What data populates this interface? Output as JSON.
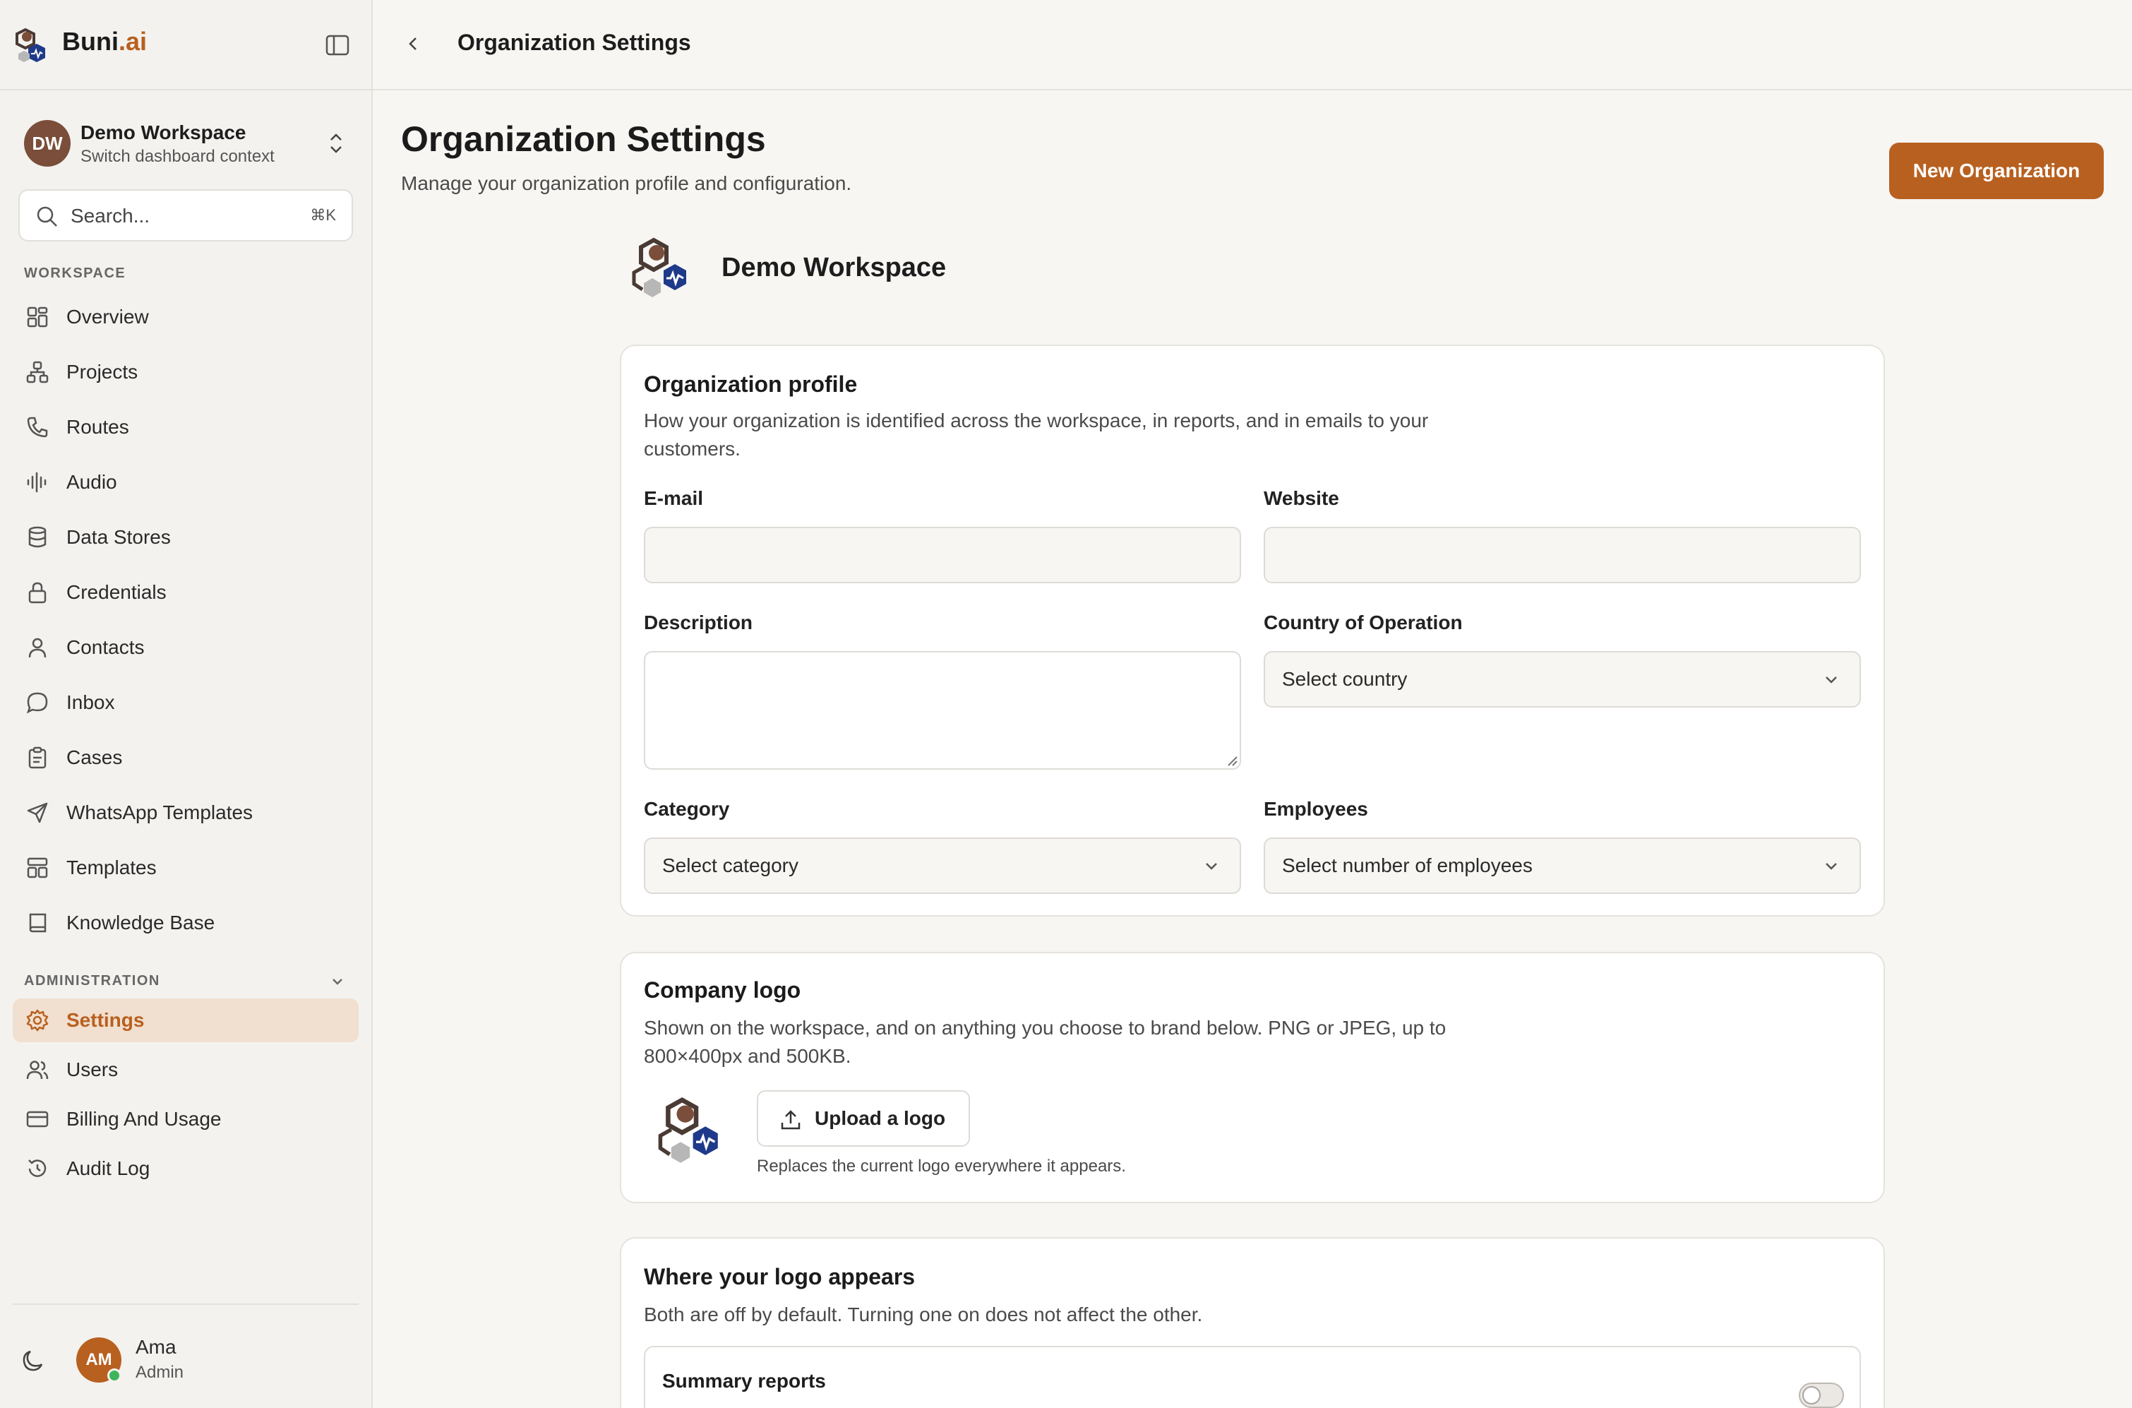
{
  "brand": {
    "name_main": "Buni",
    "name_suffix": ".ai"
  },
  "workspace": {
    "initials": "DW",
    "name": "Demo Workspace",
    "subtitle": "Switch dashboard context"
  },
  "search": {
    "placeholder": "Search...",
    "shortcut": "⌘K"
  },
  "sidebar": {
    "workspace_label": "WORKSPACE",
    "workspace_items": [
      {
        "label": "Overview",
        "icon": "grid-icon"
      },
      {
        "label": "Projects",
        "icon": "hierarchy-icon"
      },
      {
        "label": "Routes",
        "icon": "phone-icon"
      },
      {
        "label": "Audio",
        "icon": "audio-waveform-icon"
      },
      {
        "label": "Data Stores",
        "icon": "database-icon"
      },
      {
        "label": "Credentials",
        "icon": "lock-icon"
      },
      {
        "label": "Contacts",
        "icon": "user-icon"
      },
      {
        "label": "Inbox",
        "icon": "chat-bubble-icon"
      },
      {
        "label": "Cases",
        "icon": "clipboard-icon"
      },
      {
        "label": "WhatsApp Templates",
        "icon": "send-icon"
      },
      {
        "label": "Templates",
        "icon": "layout-icon"
      },
      {
        "label": "Knowledge Base",
        "icon": "book-icon"
      }
    ],
    "admin_label": "ADMINISTRATION",
    "admin_items": [
      {
        "label": "Settings",
        "icon": "gear-icon",
        "active": true
      },
      {
        "label": "Users",
        "icon": "users-icon"
      },
      {
        "label": "Billing And Usage",
        "icon": "credit-card-icon"
      },
      {
        "label": "Audit Log",
        "icon": "history-icon"
      }
    ]
  },
  "user": {
    "initials": "AM",
    "name": "Ama",
    "role": "Admin"
  },
  "topbar": {
    "title": "Organization Settings"
  },
  "page": {
    "title": "Organization Settings",
    "subtitle": "Manage your organization profile and configuration.",
    "new_org_label": "New Organization",
    "org_name": "Demo Workspace"
  },
  "profile": {
    "title": "Organization profile",
    "description": "How your organization is identified across the workspace, in reports, and in emails to your customers.",
    "email_label": "E-mail",
    "email_value": "",
    "website_label": "Website",
    "website_value": "",
    "description_label": "Description",
    "description_value": "",
    "country_label": "Country of Operation",
    "country_value": "Select country",
    "category_label": "Category",
    "category_value": "Select category",
    "employees_label": "Employees",
    "employees_value": "Select number of employees"
  },
  "logo": {
    "title": "Company logo",
    "description": "Shown on the workspace, and on anything you choose to brand below. PNG or JPEG, up to 800×400px and 500KB.",
    "upload_label": "Upload a logo",
    "hint": "Replaces the current logo everywhere it appears."
  },
  "appears": {
    "title": "Where your logo appears",
    "description": "Both are off by default. Turning one on does not affect the other.",
    "summary_reports_label": "Summary reports",
    "summary_reports_enabled": false
  },
  "colors": {
    "accent": "#b8601f",
    "active_bg": "#f1dfcf",
    "brand_navy": "#1f3a8a",
    "online": "#3fb45a"
  }
}
